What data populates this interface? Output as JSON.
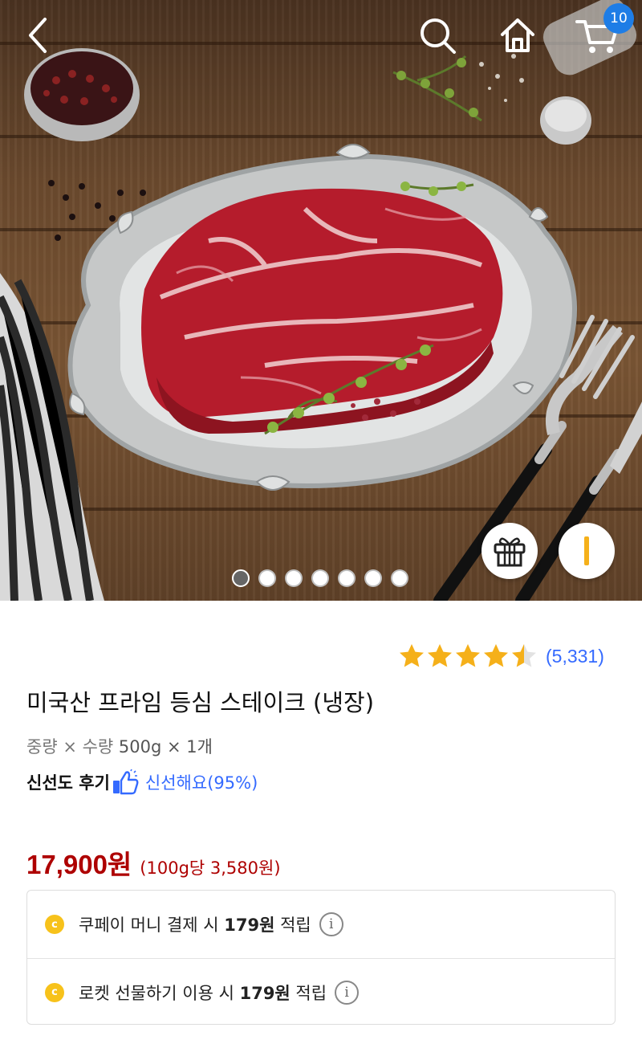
{
  "header": {
    "back_icon": "chevron-left-icon",
    "search_icon": "search-icon",
    "home_icon": "home-icon",
    "cart_icon": "cart-icon",
    "cart_count": "10"
  },
  "gallery": {
    "total_images": 7,
    "active_index": 0,
    "gift_icon": "gift-icon",
    "side_icon": "bar-icon"
  },
  "product": {
    "rating": 4.5,
    "review_count": "(5,331)",
    "title": "미국산 프라임 등심 스테이크 (냉장)",
    "option_key": "중량 × 수량",
    "option_value": "500g × 1개",
    "freshness_label": "신선도 후기",
    "freshness_value": "신선해요(95%)",
    "price": "17,900원",
    "unit_price": "(100g당 3,580원)"
  },
  "benefits": [
    {
      "prefix": "쿠페이 머니 결제 시 ",
      "amount": "179원",
      "suffix": " 적립"
    },
    {
      "prefix": "로켓 선물하기 이용 시 ",
      "amount": "179원",
      "suffix": " 적립"
    }
  ],
  "colors": {
    "price": "#ae0000",
    "link_blue": "#346aff",
    "badge_blue": "#1e7de6",
    "star": "#f5b01a",
    "coin": "#f7c21b"
  }
}
